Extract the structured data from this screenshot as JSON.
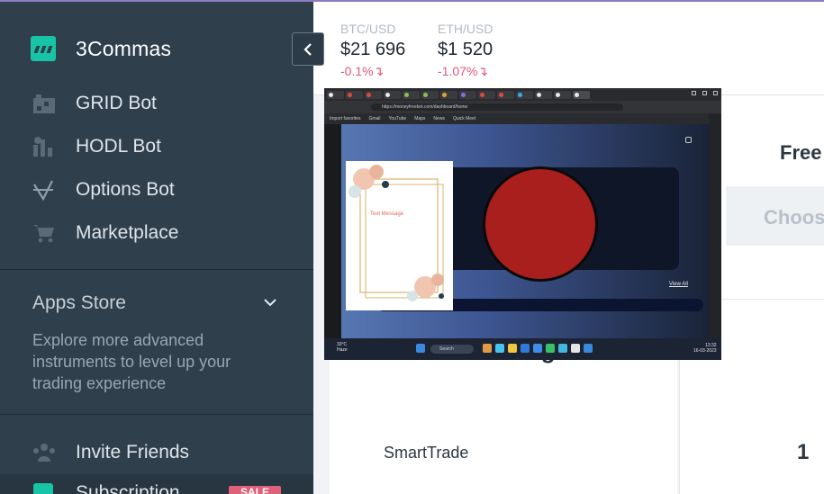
{
  "brand": {
    "name": "3Commas"
  },
  "sidebar": {
    "items": [
      {
        "label": "GRID Bot",
        "icon": "grid-bot-icon"
      },
      {
        "label": "HODL Bot",
        "icon": "hodl-bot-icon"
      },
      {
        "label": "Options Bot",
        "icon": "options-bot-icon"
      },
      {
        "label": "Marketplace",
        "icon": "cart-icon"
      }
    ],
    "apps_store": {
      "title": "Apps Store",
      "description": "Explore more advanced instruments to level up your trading experience"
    },
    "invite": {
      "label": "Invite Friends",
      "icon": "users-icon"
    },
    "subscription": {
      "label": "Subscription",
      "badge": "SALE",
      "icon": "subscription-icon"
    }
  },
  "tickers": [
    {
      "pair": "BTC/USD",
      "price": "$21 696",
      "change": "-0.1%"
    },
    {
      "pair": "ETH/USD",
      "price": "$1 520",
      "change": "-1.07%"
    }
  ],
  "main": {
    "free_label": "Free",
    "choose_label": "Choos",
    "manual_title": "Manual Trading",
    "smart_label": "SmartTrade",
    "count": "1"
  },
  "embedded_screenshot": {
    "url": "https://moneyfreebot.com/dashboard/home",
    "bookmarks": [
      "Import favorites",
      "Gmail",
      "YouTube",
      "Maps",
      "News",
      "Quick Meet"
    ],
    "card_text": "Text Message",
    "view_all": "View All",
    "search": "Search",
    "weather": [
      "33°C",
      "Haze"
    ],
    "clock": [
      "13:32",
      "16-03-2023"
    ]
  },
  "colors": {
    "sidebar_bg": "#2f3f4c",
    "brand_accent": "#17c5a6",
    "negative": "#e2577a",
    "sale": "#e0607a",
    "circle": "#a81f1e"
  }
}
